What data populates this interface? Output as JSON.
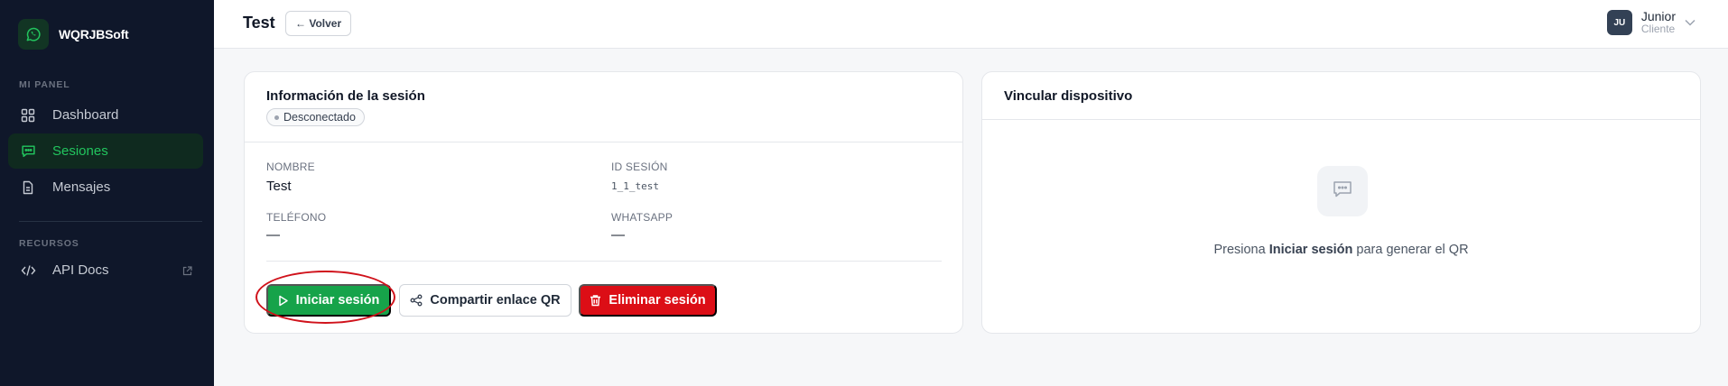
{
  "app": {
    "brand_name": "WQRJBSoft",
    "logo_icon": "whatsapp-icon",
    "accent_color": "#22c55e"
  },
  "sidebar": {
    "section_panel": "MI PANEL",
    "section_resources": "RECURSOS",
    "items": [
      {
        "label": "Dashboard",
        "icon": "grid-icon",
        "active": false
      },
      {
        "label": "Sesiones",
        "icon": "chat-icon",
        "active": true
      },
      {
        "label": "Mensajes",
        "icon": "document-icon",
        "active": false
      },
      {
        "label": "API Docs",
        "icon": "code-icon",
        "external_icon": "external-link-icon",
        "active": false
      }
    ]
  },
  "header": {
    "title": "Test",
    "back_label": "← Volver",
    "user": {
      "initials": "JU",
      "name": "Junior",
      "role": "Cliente"
    }
  },
  "session_card": {
    "title": "Información de la sesión",
    "status": "Desconectado",
    "fields": {
      "name_label": "NOMBRE",
      "name_value": "Test",
      "id_label": "ID SESIÓN",
      "id_value": "1_1_test",
      "phone_label": "TELÉFONO",
      "phone_value": "—",
      "whatsapp_label": "WHATSAPP",
      "whatsapp_value": "—"
    },
    "actions": {
      "start_label": "Iniciar sesión",
      "share_label": "Compartir enlace QR",
      "delete_label": "Eliminar sesión"
    },
    "colors": {
      "start": "#16a34a",
      "delete": "#dc0e16",
      "highlight_ring": "#d0121b"
    }
  },
  "link_card": {
    "title": "Vincular dispositivo",
    "hint_prefix": "Presiona ",
    "hint_bold": "Iniciar sesión",
    "hint_suffix": " para generar el QR"
  }
}
